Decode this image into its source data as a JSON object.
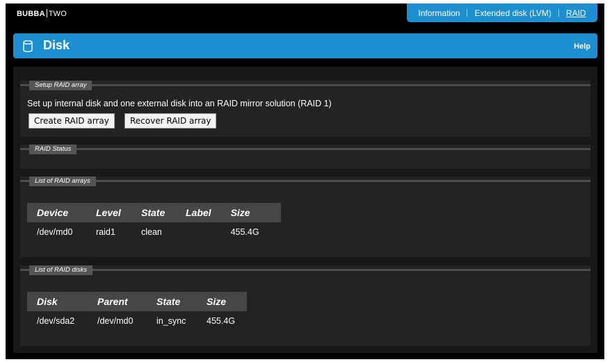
{
  "brand": {
    "left": "BUBBA",
    "right": "TWO"
  },
  "topnav": {
    "items": [
      "Information",
      "Extended disk (LVM)",
      "RAID"
    ],
    "active": "RAID"
  },
  "header": {
    "title": "Disk",
    "help": "Help",
    "icon": "database-icon"
  },
  "sections": {
    "setup": {
      "legend": "Setup RAID array",
      "description": "Set up internal disk and one external disk into an RAID mirror solution (RAID 1)",
      "create_button": "Create RAID array",
      "recover_button": "Recover RAID array"
    },
    "status": {
      "legend": "RAID Status"
    },
    "arrays": {
      "legend": "List of RAID arrays",
      "columns": [
        "Device",
        "Level",
        "State",
        "Label",
        "Size"
      ],
      "rows": [
        [
          "/dev/md0",
          "raid1",
          "clean",
          "",
          "455.4G"
        ]
      ]
    },
    "disks": {
      "legend": "List of RAID disks",
      "columns": [
        "Disk",
        "Parent",
        "State",
        "Size"
      ],
      "rows": [
        [
          "/dev/sda2",
          "/dev/md0",
          "in_sync",
          "455.4G"
        ]
      ]
    }
  },
  "colors": {
    "accent": "#1d8fd0",
    "background": "#000000",
    "panel": "#232323"
  }
}
